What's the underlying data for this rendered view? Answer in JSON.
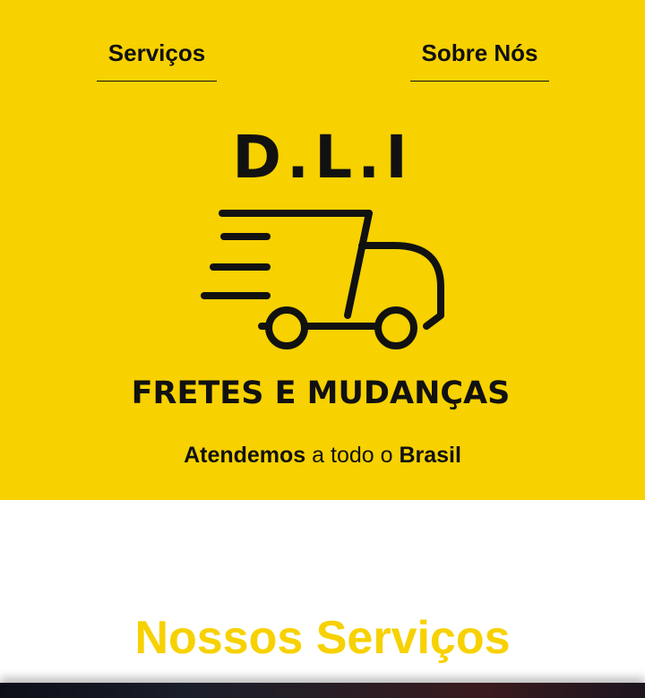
{
  "nav": {
    "services_label": "Serviços",
    "about_label": "Sobre Nós"
  },
  "logo": {
    "brand": "D.L.I",
    "subtitle": "FRETES E MUDANÇAS"
  },
  "tagline": {
    "part1": "Atendemos",
    "part2": " a todo o ",
    "part3": "Brasil"
  },
  "services_section": {
    "title": "Nossos Serviços"
  },
  "colors": {
    "brand_yellow": "#F7D100",
    "text_dark": "#111111"
  },
  "icons": [
    "delivery-truck-icon"
  ]
}
